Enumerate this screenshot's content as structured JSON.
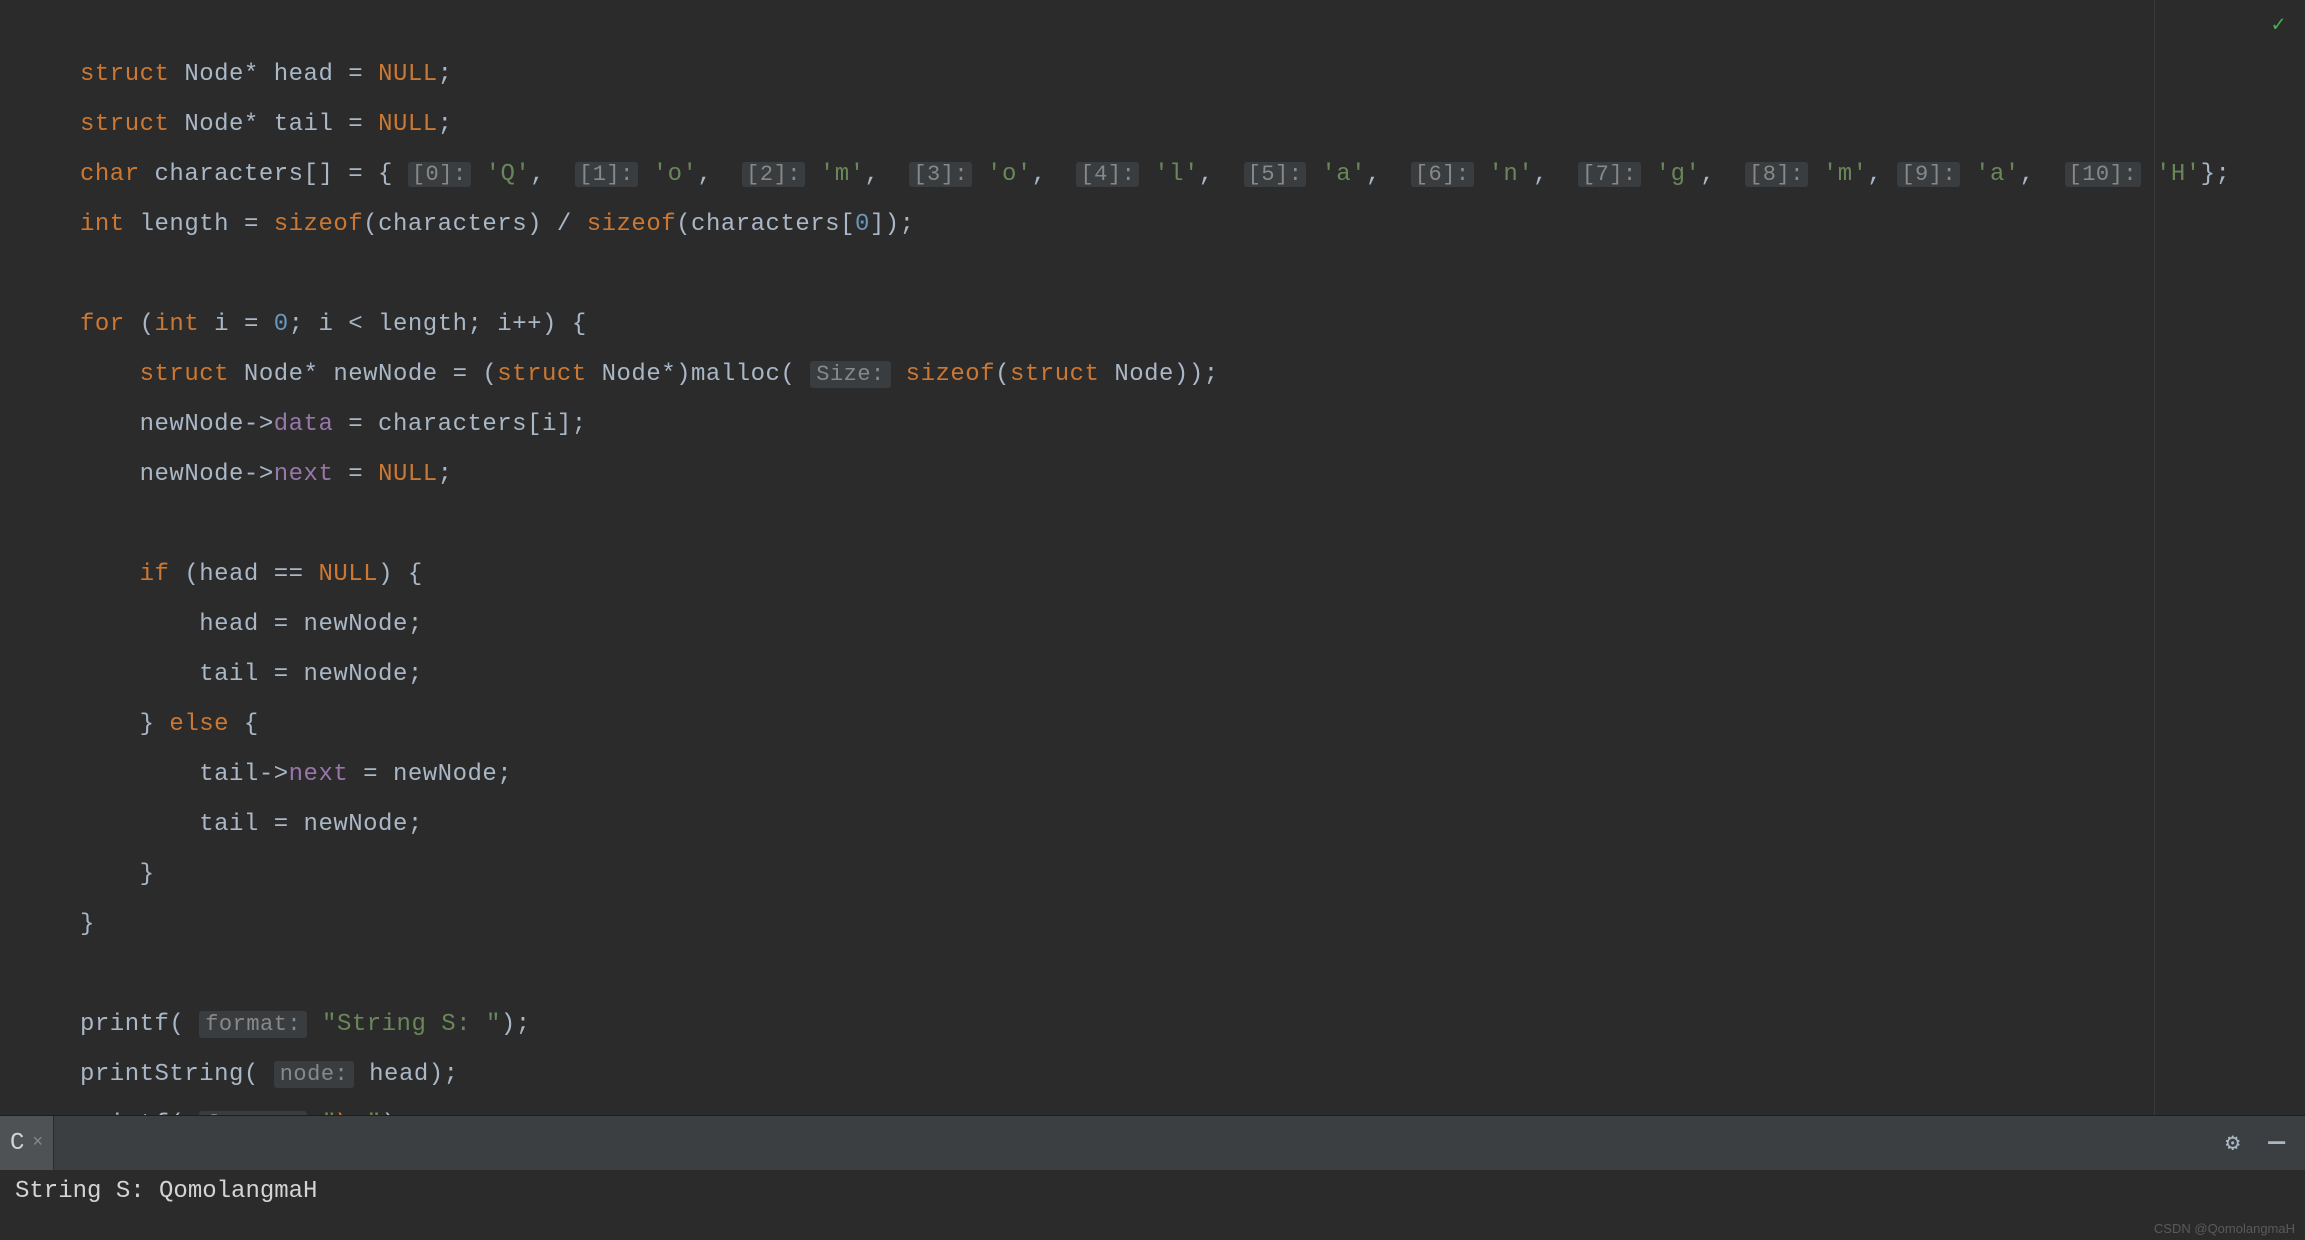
{
  "check_icon": "✓",
  "code": {
    "l1": {
      "a": "struct",
      "b": " Node* head = ",
      "c": "NULL",
      "d": ";"
    },
    "l2": {
      "a": "struct",
      "b": " Node* tail = ",
      "c": "NULL",
      "d": ";"
    },
    "l3": {
      "a": "char",
      "b": " characters[] = { ",
      "h0": "[0]:",
      "v0": "'Q'",
      "h1": "[1]:",
      "v1": "'o'",
      "h2": "[2]:",
      "v2": "'m'",
      "h3": "[3]:",
      "v3": "'o'",
      "h4": "[4]:",
      "v4": "'l'",
      "h5": "[5]:",
      "v5": "'a'",
      "h6": "[6]:",
      "v6": "'n'",
      "h7": "[7]:",
      "v7": "'g'",
      "h8": "[8]:",
      "v8": "'m'",
      "h9": "[9]:",
      "v9": "'a'",
      "h10": "[10]:",
      "v10": "'H'",
      "end": "};"
    },
    "l4": {
      "a": "int",
      "b": " length = ",
      "c": "sizeof",
      "d": "(characters) / ",
      "e": "sizeof",
      "f": "(characters[",
      "g": "0",
      "h": "]);"
    },
    "l6": {
      "a": "for",
      "b": " (",
      "c": "int",
      "d": " i = ",
      "e": "0",
      "f": "; i < length; i++) {"
    },
    "l7": {
      "a": "struct",
      "b": " Node* newNode = (",
      "c": "struct",
      "d": " Node*)malloc( ",
      "hint": "Size:",
      "e": " ",
      "f": "sizeof",
      "g": "(",
      "h": "struct",
      "i": " Node));"
    },
    "l8": {
      "a": "newNode->",
      "b": "data",
      "c": " = characters[i];"
    },
    "l9": {
      "a": "newNode->",
      "b": "next",
      "c": " = ",
      "d": "NULL",
      "e": ";"
    },
    "l11": {
      "a": "if",
      "b": " (head == ",
      "c": "NULL",
      "d": ") {"
    },
    "l12": {
      "a": "head = newNode;"
    },
    "l13": {
      "a": "tail = newNode;"
    },
    "l14": {
      "a": "} ",
      "b": "else",
      "c": " {"
    },
    "l15": {
      "a": "tail->",
      "b": "next",
      "c": " = newNode;"
    },
    "l16": {
      "a": "tail = newNode;"
    },
    "l17": {
      "a": "}"
    },
    "l18": {
      "a": "}"
    },
    "l20": {
      "a": "printf( ",
      "hint": "format:",
      "b": " ",
      "c": "\"String S: \"",
      "d": ");"
    },
    "l21": {
      "a": "printString( ",
      "hint": "node:",
      "b": " head);"
    },
    "l22": {
      "a": "printf( ",
      "hint": "format:",
      "b": " ",
      "c": "\"",
      "esc": "\\n",
      "d": "\"",
      "e": ");"
    }
  },
  "tab": {
    "label": "C",
    "close": "×"
  },
  "toolbar": {
    "gear": "⚙",
    "minus": "—"
  },
  "console_output": "String S: QomolangmaH",
  "watermark": "CSDN @QomolangmaH"
}
